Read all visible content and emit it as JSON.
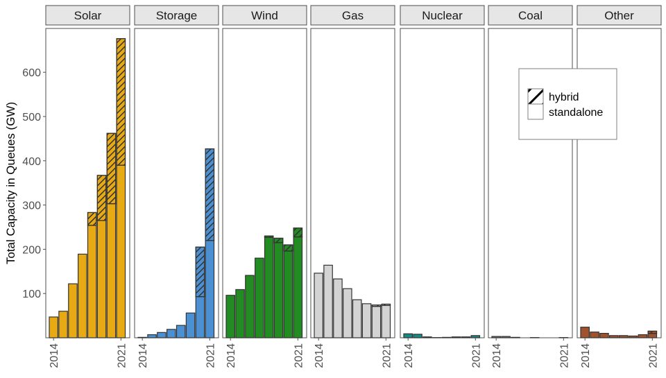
{
  "chart_data": {
    "type": "bar",
    "layout": "faceted stacked bar",
    "ylabel": "Total Capacity in Queues (GW)",
    "xlabel": "",
    "ylim": [
      0,
      690
    ],
    "yticks": [
      100,
      200,
      300,
      400,
      500,
      600
    ],
    "x": [
      2014,
      2015,
      2016,
      2017,
      2018,
      2019,
      2020,
      2021
    ],
    "xtick_labels": [
      "2014",
      "2021"
    ],
    "grid": false,
    "legend": {
      "placement": "right, inside Coal/Other panels (upper)",
      "entries": [
        {
          "label": "hybrid",
          "pattern": "hatched"
        },
        {
          "label": "standalone",
          "pattern": "solid"
        }
      ]
    },
    "facets": [
      {
        "name": "Solar",
        "color": "#E8AA14",
        "standalone": [
          47,
          60,
          122,
          189,
          254,
          265,
          303,
          390
        ],
        "hybrid": [
          0,
          0,
          0,
          0,
          29,
          102,
          159,
          286
        ]
      },
      {
        "name": "Storage",
        "color": "#4A90D2",
        "standalone": [
          1,
          7,
          12,
          19,
          28,
          56,
          93,
          220
        ],
        "hybrid": [
          0,
          0,
          0,
          0,
          0,
          0,
          112,
          207
        ]
      },
      {
        "name": "Wind",
        "color": "#228B22",
        "standalone": [
          96,
          109,
          141,
          180,
          227,
          215,
          196,
          228
        ],
        "hybrid": [
          0,
          0,
          0,
          0,
          3,
          10,
          14,
          20
        ]
      },
      {
        "name": "Gas",
        "color": "#D3D3D3",
        "standalone": [
          146,
          164,
          133,
          111,
          86,
          77,
          71,
          73
        ],
        "hybrid": [
          0,
          0,
          0,
          0,
          0,
          0,
          3,
          3
        ]
      },
      {
        "name": "Nuclear",
        "color": "#178A84",
        "standalone": [
          9,
          8,
          2,
          0.5,
          1,
          2,
          2,
          5
        ],
        "hybrid": [
          0,
          0,
          0,
          0,
          0,
          0,
          0,
          0
        ]
      },
      {
        "name": "Coal",
        "color": "#7A7A7A",
        "standalone": [
          3,
          3,
          1,
          0,
          0.5,
          0,
          0,
          0.5
        ],
        "hybrid": [
          0,
          0,
          0,
          0,
          0,
          0,
          0,
          0
        ]
      },
      {
        "name": "Other",
        "color": "#A0522D",
        "standalone": [
          24,
          13,
          10,
          5,
          5,
          4,
          7,
          10
        ],
        "hybrid": [
          0,
          0,
          0,
          0,
          0,
          0,
          0,
          5
        ]
      }
    ]
  }
}
